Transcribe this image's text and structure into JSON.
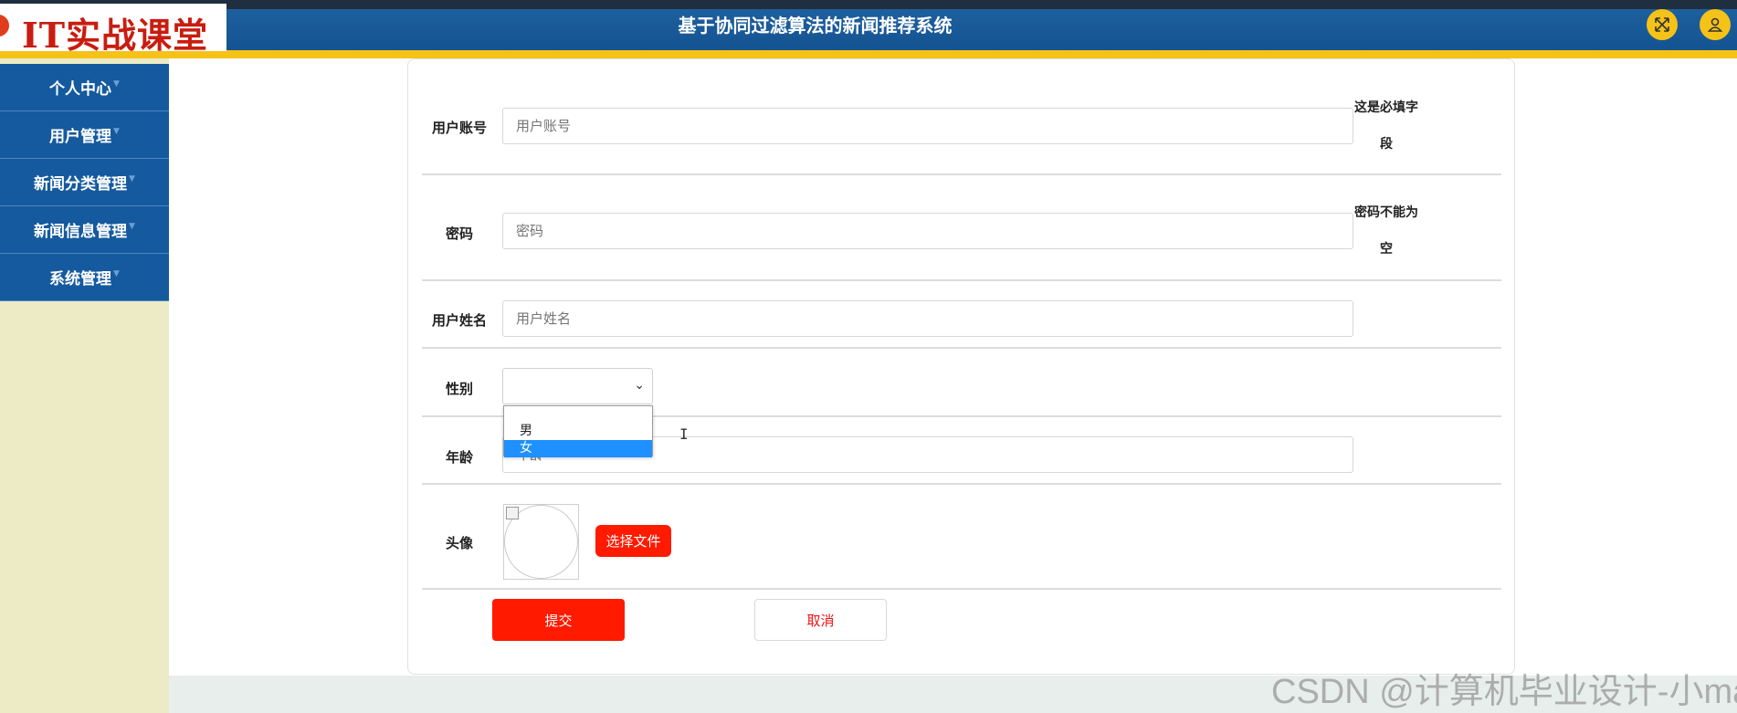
{
  "header": {
    "logo_text": "IT实战课堂",
    "title": "基于协同过滤算法的新闻推荐系统",
    "buttons": [
      {
        "icon": "fullscreen-icon"
      },
      {
        "icon": "user-icon"
      }
    ]
  },
  "sidebar": {
    "items": [
      {
        "label": "个人中心"
      },
      {
        "label": "用户管理"
      },
      {
        "label": "新闻分类管理"
      },
      {
        "label": "新闻信息管理"
      },
      {
        "label": "系统管理"
      }
    ]
  },
  "form": {
    "account": {
      "label": "用户账号",
      "placeholder": "用户账号",
      "hint_line1": "这是必填字",
      "hint_line2": "段"
    },
    "password": {
      "label": "密码",
      "placeholder": "密码",
      "hint_line1": "密码不能为",
      "hint_line2": "空"
    },
    "name": {
      "label": "用户姓名",
      "placeholder": "用户姓名"
    },
    "gender": {
      "label": "性别",
      "selected": "",
      "options": [
        "男",
        "女"
      ],
      "highlighted": "女"
    },
    "age": {
      "label": "年龄",
      "placeholder": "年龄"
    },
    "avatar": {
      "label": "头像",
      "choose_file": "选择文件"
    },
    "submit": "提交",
    "cancel": "取消"
  },
  "watermark": "CSDN @计算机毕业设计-小ma",
  "colors": {
    "header": "#145391",
    "accent": "#f5c217",
    "sidebar_bg": "#ecebc5",
    "primary_button": "#ff1a00"
  }
}
